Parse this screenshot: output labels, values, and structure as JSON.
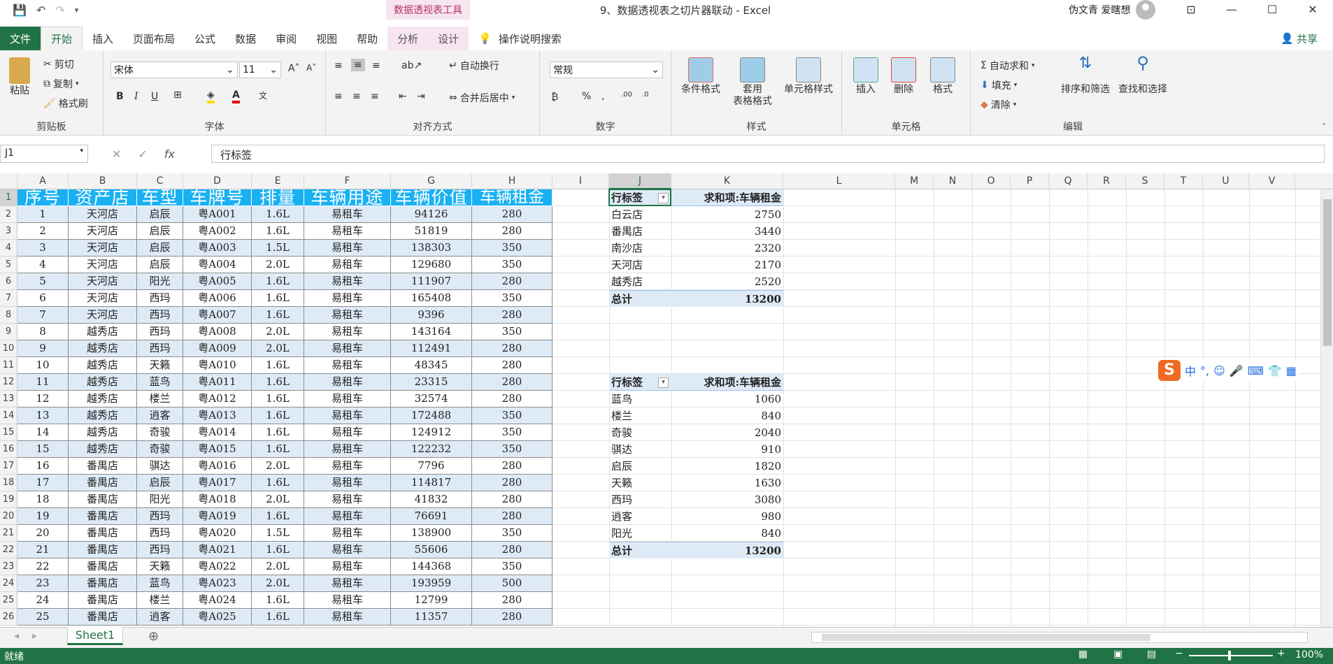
{
  "app": {
    "context_tool_title": "数据透视表工具",
    "document_title": "9、数据透视表之切片器联动  -  Excel",
    "user_name": "伪文青 爱瞎想",
    "share_label": "共享"
  },
  "tabs": [
    "文件",
    "开始",
    "插入",
    "页面布局",
    "公式",
    "数据",
    "审阅",
    "视图",
    "帮助",
    "分析",
    "设计",
    "操作说明搜索"
  ],
  "ribbon": {
    "clipboard": {
      "paste": "粘贴",
      "cut": "剪切",
      "copy": "复制",
      "format_painter": "格式刷",
      "label": "剪贴板"
    },
    "font": {
      "name": "宋体",
      "size": "11",
      "label": "字体"
    },
    "alignment": {
      "wrap": "自动换行",
      "merge": "合并后居中",
      "label": "对齐方式"
    },
    "number": {
      "format": "常规",
      "label": "数字"
    },
    "styles": {
      "conditional": "条件格式",
      "table1": "套用",
      "table2": "表格格式",
      "cell_styles": "单元格样式",
      "label": "样式"
    },
    "cells": {
      "insert": "插入",
      "delete": "删除",
      "format": "格式",
      "label": "单元格"
    },
    "editing": {
      "autosum": "自动求和",
      "fill": "填充",
      "clear": "清除",
      "sort_filter": "排序和筛选",
      "find_select": "查找和选择",
      "label": "编辑"
    }
  },
  "formula_bar": {
    "name_box": "J1",
    "formula": "行标签"
  },
  "columns": [
    "A",
    "B",
    "C",
    "D",
    "E",
    "F",
    "G",
    "H",
    "I",
    "J",
    "K",
    "L",
    "M",
    "N",
    "O",
    "P",
    "Q",
    "R",
    "S",
    "T",
    "U",
    "V"
  ],
  "table": {
    "headers": [
      "序号",
      "资产店",
      "车型",
      "车牌号",
      "排量",
      "车辆用途",
      "车辆价值",
      "车辆租金"
    ],
    "rows": [
      [
        "1",
        "天河店",
        "启辰",
        "粤A001",
        "1.6L",
        "易租车",
        "94126",
        "280"
      ],
      [
        "2",
        "天河店",
        "启辰",
        "粤A002",
        "1.6L",
        "易租车",
        "51819",
        "280"
      ],
      [
        "3",
        "天河店",
        "启辰",
        "粤A003",
        "1.5L",
        "易租车",
        "138303",
        "350"
      ],
      [
        "4",
        "天河店",
        "启辰",
        "粤A004",
        "2.0L",
        "易租车",
        "129680",
        "350"
      ],
      [
        "5",
        "天河店",
        "阳光",
        "粤A005",
        "1.6L",
        "易租车",
        "111907",
        "280"
      ],
      [
        "6",
        "天河店",
        "西玛",
        "粤A006",
        "1.6L",
        "易租车",
        "165408",
        "350"
      ],
      [
        "7",
        "天河店",
        "西玛",
        "粤A007",
        "1.6L",
        "易租车",
        "9396",
        "280"
      ],
      [
        "8",
        "越秀店",
        "西玛",
        "粤A008",
        "2.0L",
        "易租车",
        "143164",
        "350"
      ],
      [
        "9",
        "越秀店",
        "西玛",
        "粤A009",
        "2.0L",
        "易租车",
        "112491",
        "280"
      ],
      [
        "10",
        "越秀店",
        "天籁",
        "粤A010",
        "1.6L",
        "易租车",
        "48345",
        "280"
      ],
      [
        "11",
        "越秀店",
        "蓝鸟",
        "粤A011",
        "1.6L",
        "易租车",
        "23315",
        "280"
      ],
      [
        "12",
        "越秀店",
        "楼兰",
        "粤A012",
        "1.6L",
        "易租车",
        "32574",
        "280"
      ],
      [
        "13",
        "越秀店",
        "逍客",
        "粤A013",
        "1.6L",
        "易租车",
        "172488",
        "350"
      ],
      [
        "14",
        "越秀店",
        "奇骏",
        "粤A014",
        "1.6L",
        "易租车",
        "124912",
        "350"
      ],
      [
        "15",
        "越秀店",
        "奇骏",
        "粤A015",
        "1.6L",
        "易租车",
        "122232",
        "350"
      ],
      [
        "16",
        "番禺店",
        "骐达",
        "粤A016",
        "2.0L",
        "易租车",
        "7796",
        "280"
      ],
      [
        "17",
        "番禺店",
        "启辰",
        "粤A017",
        "1.6L",
        "易租车",
        "114817",
        "280"
      ],
      [
        "18",
        "番禺店",
        "阳光",
        "粤A018",
        "2.0L",
        "易租车",
        "41832",
        "280"
      ],
      [
        "19",
        "番禺店",
        "西玛",
        "粤A019",
        "1.6L",
        "易租车",
        "76691",
        "280"
      ],
      [
        "20",
        "番禺店",
        "西玛",
        "粤A020",
        "1.5L",
        "易租车",
        "138900",
        "350"
      ],
      [
        "21",
        "番禺店",
        "西玛",
        "粤A021",
        "1.6L",
        "易租车",
        "55606",
        "280"
      ],
      [
        "22",
        "番禺店",
        "天籁",
        "粤A022",
        "2.0L",
        "易租车",
        "144368",
        "350"
      ],
      [
        "23",
        "番禺店",
        "蓝鸟",
        "粤A023",
        "2.0L",
        "易租车",
        "193959",
        "500"
      ],
      [
        "24",
        "番禺店",
        "楼兰",
        "粤A024",
        "1.6L",
        "易租车",
        "12799",
        "280"
      ],
      [
        "25",
        "番禺店",
        "逍客",
        "粤A025",
        "1.6L",
        "易租车",
        "11357",
        "280"
      ]
    ]
  },
  "pivot1": {
    "row_label": "行标签",
    "value_label": "求和项:车辆租金",
    "rows": [
      [
        "白云店",
        "2750"
      ],
      [
        "番禺店",
        "3440"
      ],
      [
        "南沙店",
        "2320"
      ],
      [
        "天河店",
        "2170"
      ],
      [
        "越秀店",
        "2520"
      ]
    ],
    "total_label": "总计",
    "total": "13200"
  },
  "pivot2": {
    "row_label": "行标签",
    "value_label": "求和项:车辆租金",
    "rows": [
      [
        "蓝鸟",
        "1060"
      ],
      [
        "楼兰",
        "840"
      ],
      [
        "奇骏",
        "2040"
      ],
      [
        "骐达",
        "910"
      ],
      [
        "启辰",
        "1820"
      ],
      [
        "天籁",
        "1630"
      ],
      [
        "西玛",
        "3080"
      ],
      [
        "逍客",
        "980"
      ],
      [
        "阳光",
        "840"
      ]
    ],
    "total_label": "总计",
    "total": "13200"
  },
  "sheet": {
    "tab": "Sheet1"
  },
  "status": {
    "ready": "就绪",
    "zoom": "100%"
  },
  "ime": {
    "mode": "中"
  }
}
